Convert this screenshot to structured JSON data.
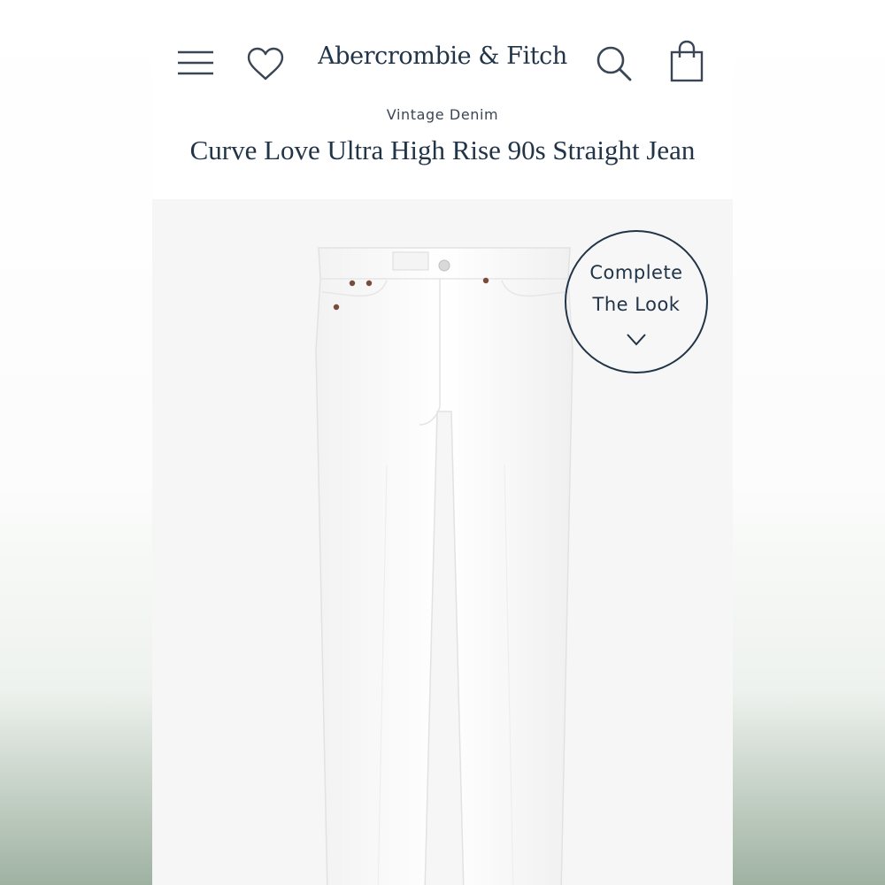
{
  "header": {
    "brand": "Abercrombie & Fitch",
    "icons": [
      "menu-icon",
      "heart-icon",
      "search-icon",
      "shopping-bag-icon"
    ]
  },
  "product": {
    "category": "Vintage Denim",
    "title": "Curve Love Ultra High Rise 90s Straight Jean"
  },
  "complete_the_look": {
    "line1": "Complete",
    "line2": "The Look"
  },
  "colors": {
    "navy": "#213448",
    "product_white": "#ffffff",
    "rivet": "#7a4a3c"
  }
}
